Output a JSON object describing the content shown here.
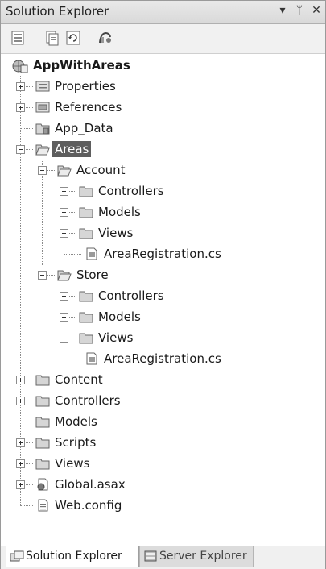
{
  "window": {
    "title": "Solution Explorer",
    "dropdown_glyph": "▾",
    "pin_glyph": "ᛘ",
    "close_glyph": "✕"
  },
  "toolbar": {
    "buttons": [
      "properties-icon",
      "show-all-files-icon",
      "refresh-icon",
      "class-diagram-icon"
    ]
  },
  "tree": {
    "project": "AppWithAreas",
    "properties": "Properties",
    "references": "References",
    "app_data": "App_Data",
    "areas": "Areas",
    "account": "Account",
    "account_controllers": "Controllers",
    "account_models": "Models",
    "account_views": "Views",
    "account_registration": "AreaRegistration.cs",
    "store": "Store",
    "store_controllers": "Controllers",
    "store_models": "Models",
    "store_views": "Views",
    "store_registration": "AreaRegistration.cs",
    "content": "Content",
    "controllers": "Controllers",
    "models": "Models",
    "scripts": "Scripts",
    "views": "Views",
    "global_asax": "Global.asax",
    "web_config": "Web.config"
  },
  "tabs": {
    "solution_explorer": "Solution Explorer",
    "server_explorer": "Server Explorer"
  },
  "colors": {
    "selection": "#5e5e5e",
    "folder": "#d6d6d6"
  }
}
